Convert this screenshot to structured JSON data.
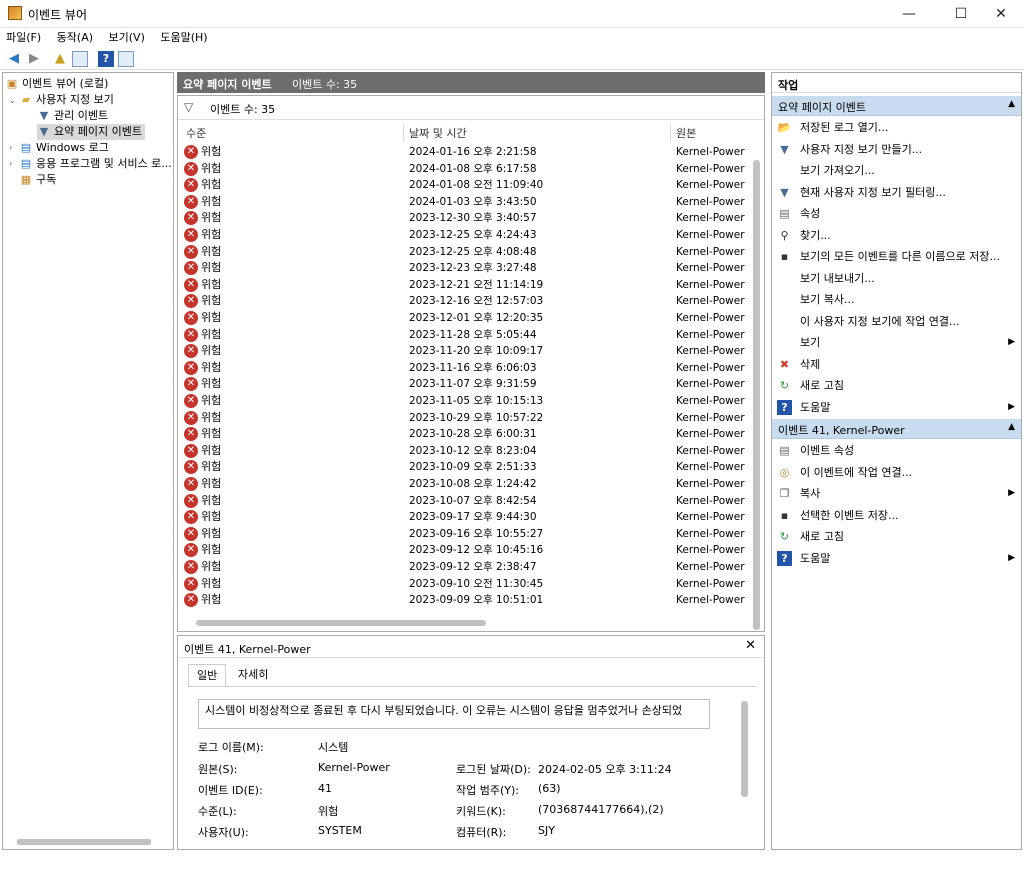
{
  "window": {
    "title": "이벤트 뷰어",
    "minimize": "—",
    "maximize": "☐",
    "close": "✕"
  },
  "menu": [
    "파일(F)",
    "동작(A)",
    "보기(V)",
    "도움말(H)"
  ],
  "tree": {
    "root": "이벤트 뷰어 (로컬)",
    "custom_views": "사용자 지정 보기",
    "admin_events": "관리 이벤트",
    "summary_events": "요약 페이지 이벤트",
    "windows_logs": "Windows 로그",
    "app_service_logs": "응용 프로그램 및 서비스 로...",
    "subscriptions": "구독"
  },
  "center": {
    "header_title": "요약 페이지 이벤트",
    "header_count": "이벤트 수: 35",
    "filter_text": "이벤트 수: 35",
    "columns": {
      "level": "수준",
      "datetime": "날짜 및 시간",
      "source": "원본"
    }
  },
  "events": [
    {
      "level": "위험",
      "datetime": "2024-01-16 오후 2:21:58",
      "source": "Kernel-Power"
    },
    {
      "level": "위험",
      "datetime": "2024-01-08 오후 6:17:58",
      "source": "Kernel-Power"
    },
    {
      "level": "위험",
      "datetime": "2024-01-08 오전 11:09:40",
      "source": "Kernel-Power"
    },
    {
      "level": "위험",
      "datetime": "2024-01-03 오후 3:43:50",
      "source": "Kernel-Power"
    },
    {
      "level": "위험",
      "datetime": "2023-12-30 오후 3:40:57",
      "source": "Kernel-Power"
    },
    {
      "level": "위험",
      "datetime": "2023-12-25 오후 4:24:43",
      "source": "Kernel-Power"
    },
    {
      "level": "위험",
      "datetime": "2023-12-25 오후 4:08:48",
      "source": "Kernel-Power"
    },
    {
      "level": "위험",
      "datetime": "2023-12-23 오후 3:27:48",
      "source": "Kernel-Power"
    },
    {
      "level": "위험",
      "datetime": "2023-12-21 오전 11:14:19",
      "source": "Kernel-Power"
    },
    {
      "level": "위험",
      "datetime": "2023-12-16 오전 12:57:03",
      "source": "Kernel-Power"
    },
    {
      "level": "위험",
      "datetime": "2023-12-01 오후 12:20:35",
      "source": "Kernel-Power"
    },
    {
      "level": "위험",
      "datetime": "2023-11-28 오후 5:05:44",
      "source": "Kernel-Power"
    },
    {
      "level": "위험",
      "datetime": "2023-11-20 오후 10:09:17",
      "source": "Kernel-Power"
    },
    {
      "level": "위험",
      "datetime": "2023-11-16 오후 6:06:03",
      "source": "Kernel-Power"
    },
    {
      "level": "위험",
      "datetime": "2023-11-07 오후 9:31:59",
      "source": "Kernel-Power"
    },
    {
      "level": "위험",
      "datetime": "2023-11-05 오후 10:15:13",
      "source": "Kernel-Power"
    },
    {
      "level": "위험",
      "datetime": "2023-10-29 오후 10:57:22",
      "source": "Kernel-Power"
    },
    {
      "level": "위험",
      "datetime": "2023-10-28 오후 6:00:31",
      "source": "Kernel-Power"
    },
    {
      "level": "위험",
      "datetime": "2023-10-12 오후 8:23:04",
      "source": "Kernel-Power"
    },
    {
      "level": "위험",
      "datetime": "2023-10-09 오후 2:51:33",
      "source": "Kernel-Power"
    },
    {
      "level": "위험",
      "datetime": "2023-10-08 오후 1:24:42",
      "source": "Kernel-Power"
    },
    {
      "level": "위험",
      "datetime": "2023-10-07 오후 8:42:54",
      "source": "Kernel-Power"
    },
    {
      "level": "위험",
      "datetime": "2023-09-17 오후 9:44:30",
      "source": "Kernel-Power"
    },
    {
      "level": "위험",
      "datetime": "2023-09-16 오후 10:55:27",
      "source": "Kernel-Power"
    },
    {
      "level": "위험",
      "datetime": "2023-09-12 오후 10:45:16",
      "source": "Kernel-Power"
    },
    {
      "level": "위험",
      "datetime": "2023-09-12 오후 2:38:47",
      "source": "Kernel-Power"
    },
    {
      "level": "위험",
      "datetime": "2023-09-10 오전 11:30:45",
      "source": "Kernel-Power"
    },
    {
      "level": "위험",
      "datetime": "2023-09-09 오후 10:51:01",
      "source": "Kernel-Power"
    }
  ],
  "detail": {
    "title": "이벤트 41, Kernel-Power",
    "close": "✕",
    "tabs": [
      "일반",
      "자세히"
    ],
    "message": "시스템이 비정상적으로 종료된 후 다시 부팅되었습니다. 이 오류는 시스템이 응답을 멈추었거나 손상되었",
    "fields": {
      "log_name_label": "로그 이름(M):",
      "log_name": "시스템",
      "source_label": "원본(S):",
      "source": "Kernel-Power",
      "logged_label": "로그된 날짜(D):",
      "logged": "2024-02-05 오후 3:11:24",
      "event_id_label": "이벤트 ID(E):",
      "event_id": "41",
      "task_label": "작업 범주(Y):",
      "task": "(63)",
      "level_label": "수준(L):",
      "level": "위험",
      "keywords_label": "키워드(K):",
      "keywords": "(70368744177664),(2)",
      "user_label": "사용자(U):",
      "user": "SYSTEM",
      "computer_label": "컴퓨터(R):",
      "computer": "SJY"
    }
  },
  "actions": {
    "title": "작업",
    "section1": "요약 페이지 이벤트",
    "items1": [
      {
        "label": "저장된 로그 열기...",
        "icon": "folder-open-icon"
      },
      {
        "label": "사용자 지정 보기 만들기...",
        "icon": "filter-icon"
      },
      {
        "label": "보기 가져오기...",
        "icon": ""
      },
      {
        "label": "현재 사용자 지정 보기 필터링...",
        "icon": "filter-icon"
      },
      {
        "label": "속성",
        "icon": "properties-icon"
      },
      {
        "label": "찾기...",
        "icon": "binoculars-icon"
      },
      {
        "label": "보기의 모든 이벤트를 다른 이름으로 저장...",
        "icon": "save-icon"
      },
      {
        "label": "보기 내보내기...",
        "icon": ""
      },
      {
        "label": "보기 복사...",
        "icon": ""
      },
      {
        "label": "이 사용자 지정 보기에 작업 연결...",
        "icon": ""
      },
      {
        "label": "보기",
        "icon": ""
      },
      {
        "label": "삭제",
        "icon": "delete-icon"
      },
      {
        "label": "새로 고침",
        "icon": "refresh-icon"
      },
      {
        "label": "도움말",
        "icon": "help-icon"
      }
    ],
    "section2": "이벤트 41, Kernel-Power",
    "items2": [
      {
        "label": "이벤트 속성",
        "icon": "event-properties-icon"
      },
      {
        "label": "이 이벤트에 작업 연결...",
        "icon": "attach-task-icon"
      },
      {
        "label": "복사",
        "icon": "copy-icon"
      },
      {
        "label": "선택한 이벤트 저장...",
        "icon": "save-icon"
      },
      {
        "label": "새로 고침",
        "icon": "refresh-icon"
      },
      {
        "label": "도움말",
        "icon": "help-icon"
      }
    ]
  }
}
